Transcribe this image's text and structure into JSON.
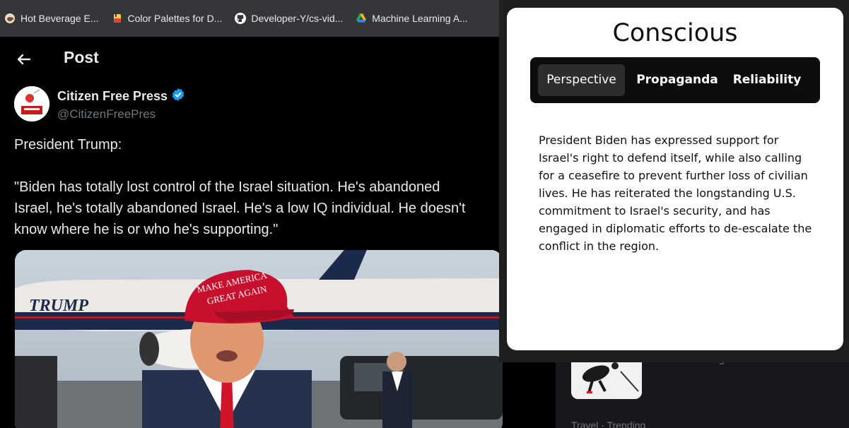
{
  "bookmarks": [
    {
      "label": "Hot Beverage E...",
      "icon": "coffee-cup-icon"
    },
    {
      "label": "Color Palettes for D...",
      "icon": "palette-icon"
    },
    {
      "label": "Developer-Y/cs-vid...",
      "icon": "github-icon"
    },
    {
      "label": "Machine Learning A...",
      "icon": "google-drive-icon"
    }
  ],
  "post": {
    "header_title": "Post",
    "author_name": "Citizen Free Press",
    "author_handle": "@CitizenFreePres",
    "text_line1": "President Trump:",
    "text_line2": "\"Biden has totally lost control of the Israel situation. He's abandoned",
    "text_line3": "Israel, he's totally abandoned Israel. He's a low IQ individual. He doesn't",
    "text_line4": "know where he is or who he's supporting.\"",
    "media": {
      "plane_text": "TRUMP",
      "hat_line1": "MAKE AMERICA",
      "hat_line2": "GREAT AGAIN"
    }
  },
  "sidebar": {
    "faded_item": "Trending",
    "trend_meta": "Travel · Trending"
  },
  "popup": {
    "title": "Conscious",
    "tabs": [
      "Perspective",
      "Propaganda",
      "Reliability"
    ],
    "active_tab": "Perspective",
    "body": "President Biden has expressed support for Israel's right to defend itself, while also calling for a ceasefire to prevent further loss of civilian lives. He has reiterated the longstanding U.S. commitment to Israel's security, and has engaged in diplomatic efforts to de-escalate the conflict in the region."
  },
  "colors": {
    "background": "#000000",
    "bookmarks_bar": "#35363a",
    "verified_badge": "#1d9bf0",
    "popup_bg": "#ffffff",
    "tabbar_bg": "#0d0d0d",
    "hat_red": "#c8102e"
  }
}
